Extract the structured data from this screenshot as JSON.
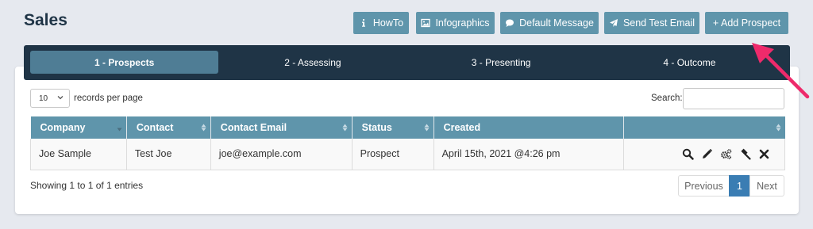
{
  "page": {
    "title": "Sales"
  },
  "toolbar": {
    "howto": "HowTo",
    "infographics": "Infographics",
    "default_message": "Default Message",
    "send_test_email": "Send Test Email",
    "add_prospect": "+ Add Prospect"
  },
  "tabs": [
    {
      "label": "1 - Prospects",
      "active": true
    },
    {
      "label": "2 - Assessing",
      "active": false
    },
    {
      "label": "3 - Presenting",
      "active": false
    },
    {
      "label": "4 - Outcome",
      "active": false
    }
  ],
  "controls": {
    "page_length": "10",
    "records_label": "records per page",
    "search_label": "Search:",
    "search_value": ""
  },
  "table": {
    "headers": [
      "Company",
      "Contact",
      "Contact Email",
      "Status",
      "Created",
      ""
    ],
    "rows": [
      {
        "company": "Joe Sample",
        "contact": "Test Joe",
        "email": "joe@example.com",
        "status": "Prospect",
        "created": "April 15th, 2021 @4:26 pm"
      }
    ],
    "row_actions": [
      "search-icon",
      "pencil-icon",
      "gears-icon",
      "gavel-icon",
      "close-icon"
    ]
  },
  "footer": {
    "info": "Showing 1 to 1 of 1 entries",
    "previous": "Previous",
    "current_page": "1",
    "next": "Next"
  },
  "colors": {
    "background": "#e6e9ef",
    "button": "#5f95ab",
    "tabs_bar": "#1f3446",
    "active_tab": "#4f7d95",
    "pager_active": "#3a7db3",
    "annotation_arrow": "#ee2a6b"
  }
}
